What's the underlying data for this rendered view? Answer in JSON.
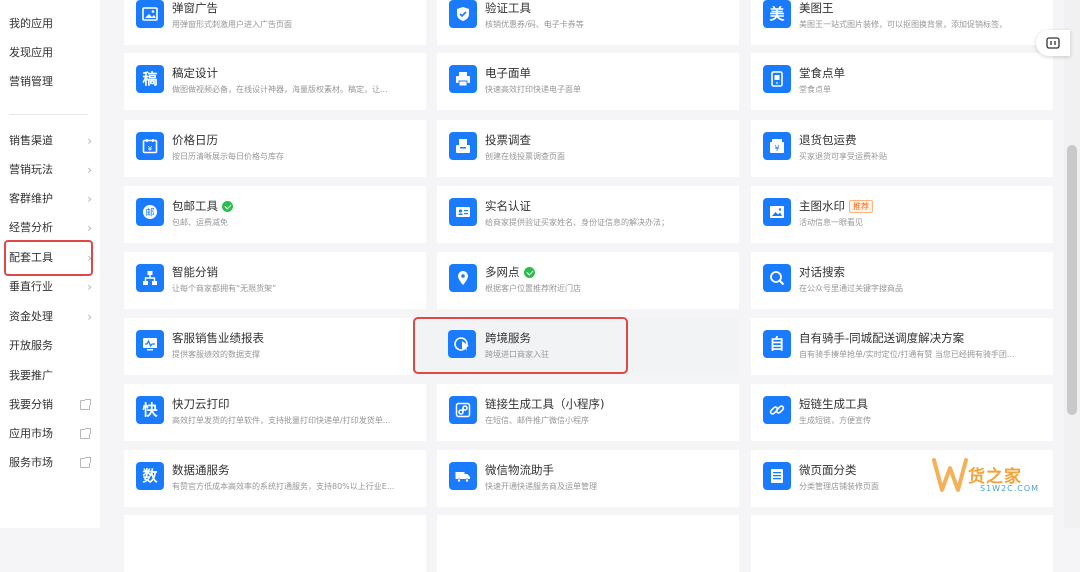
{
  "sidebar": {
    "top_items": [
      "我的应用",
      "发现应用",
      "营销管理"
    ],
    "menu_items": [
      {
        "label": "销售渠道",
        "marker": "chevron"
      },
      {
        "label": "营销玩法",
        "marker": "chevron"
      },
      {
        "label": "客群维护",
        "marker": "chevron"
      },
      {
        "label": "经营分析",
        "marker": "chevron"
      },
      {
        "label": "配套工具",
        "marker": "chevron"
      },
      {
        "label": "垂直行业",
        "marker": "chevron"
      },
      {
        "label": "资金处理",
        "marker": "chevron"
      },
      {
        "label": "开放服务",
        "marker": "none"
      },
      {
        "label": "我要推广",
        "marker": "none"
      },
      {
        "label": "我要分销",
        "marker": "external"
      },
      {
        "label": "应用市场",
        "marker": "external"
      },
      {
        "label": "服务市场",
        "marker": "external"
      }
    ],
    "selected": "配套工具"
  },
  "cards": [
    {
      "title": "弹窗广告",
      "desc": "用弹窗形式刺激用户进入广告页面",
      "icon": "image-icon"
    },
    {
      "title": "验证工具",
      "desc": "核销优惠券/码、电子卡券等",
      "icon": "shield-check-icon"
    },
    {
      "title": "美图王",
      "desc": "美图王一站式图片装修，可以抠图换背景，添加促销标签，",
      "icon": "meitu-icon",
      "glyph": "美"
    },
    {
      "title": "稿定设计",
      "desc": "做图做视频必备，在线设计神器，海量版权素材。稿定，让...",
      "icon": "gaoding-icon",
      "glyph": "稿"
    },
    {
      "title": "电子面单",
      "desc": "快速高效打印快递电子面单",
      "icon": "printer-icon"
    },
    {
      "title": "堂食点单",
      "desc": "堂食点单",
      "icon": "tablet-icon"
    },
    {
      "title": "价格日历",
      "desc": "按日历清晰展示每日价格与库存",
      "icon": "calendar-icon"
    },
    {
      "title": "投票调查",
      "desc": "创建在线投票调查页面",
      "icon": "ballot-box-icon"
    },
    {
      "title": "退货包运费",
      "desc": "买家退货可享受运费补贴",
      "icon": "return-shipping-icon"
    },
    {
      "title": "包邮工具",
      "desc": "包邮、运费减免",
      "icon": "mail-icon",
      "glyph": "邮",
      "badge": "green"
    },
    {
      "title": "实名认证",
      "desc": "给商家提供验证买家姓名、身份证信息的解决办法；",
      "icon": "id-card-icon"
    },
    {
      "title": "主图水印",
      "desc": "活动信息一眼看见",
      "icon": "watermark-image-icon",
      "tag": "推荐"
    },
    {
      "title": "智能分销",
      "desc": "让每个商家都拥有“无限货架”",
      "icon": "network-icon"
    },
    {
      "title": "多网点",
      "desc": "根据客户位置推荐附近门店",
      "icon": "location-icon",
      "badge": "green"
    },
    {
      "title": "对话搜索",
      "desc": "在公众号里通过关键字搜商品",
      "icon": "search-icon"
    },
    {
      "title": "客服销售业绩报表",
      "desc": "提供客服绩效的数据支撑",
      "icon": "report-icon"
    },
    {
      "title": "跨境服务",
      "desc": "跨境进口商家入驻",
      "icon": "cross-border-plane-icon"
    },
    {
      "title": "自有骑手-同城配送调度解决方案",
      "desc": "自有骑手揍单抢单/实时定位/打通有赞 当您已经拥有骑手团...",
      "icon": "rider-icon",
      "glyph": "自"
    },
    {
      "title": "快刀云打印",
      "desc": "高效打单发货的打单软件，支持批量打印快递单/打印发货单...",
      "icon": "kuaidao-icon",
      "glyph": "快"
    },
    {
      "title": "链接生成工具（小程序)",
      "desc": "在短信、邮件推广微信小程序",
      "icon": "mini-program-icon"
    },
    {
      "title": "短链生成工具",
      "desc": "生成短链，方便宣传",
      "icon": "link-icon"
    },
    {
      "title": "数据通服务",
      "desc": "有赞官方低成本高效率的系统打通服务，支持80%以上行业E...",
      "icon": "data-icon",
      "glyph": "数"
    },
    {
      "title": "微信物流助手",
      "desc": "快速开通快递服务商及运单管理",
      "icon": "truck-icon"
    },
    {
      "title": "微页面分类",
      "desc": "分类管理店铺装修页面",
      "icon": "page-list-icon"
    }
  ],
  "hover_card": "跨境服务",
  "watermark": {
    "cn": "货之家",
    "en": "S1W2C.COM"
  },
  "colors": {
    "accent": "#1b7bff",
    "highlight": "#e04848",
    "badge_green": "#2ebc4f",
    "tag_orange": "#ff6a13"
  }
}
